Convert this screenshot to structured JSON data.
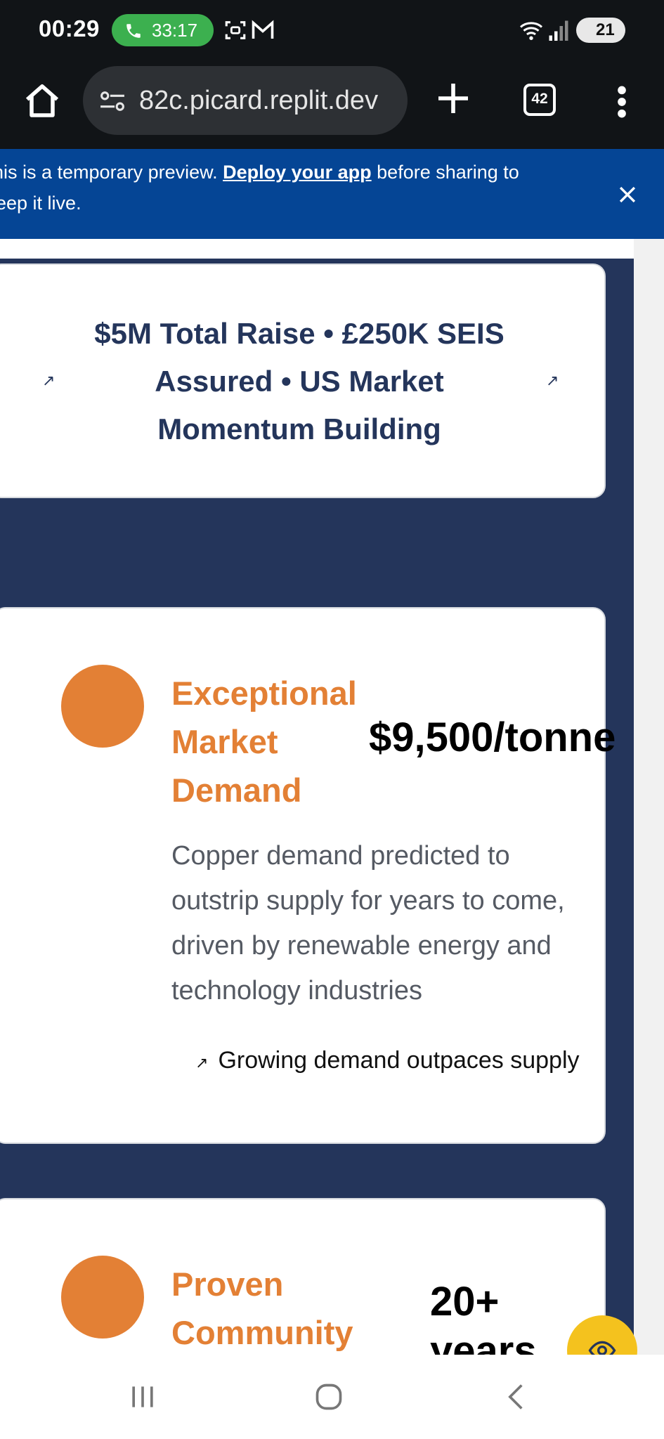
{
  "status_bar": {
    "time": "00:29",
    "call_timer": "33:17",
    "battery": "21",
    "icons": [
      "phone-icon",
      "screenshot-icon",
      "gmail-icon",
      "wifi-icon",
      "signal-icon",
      "battery-icon"
    ]
  },
  "browser": {
    "url": "82c.picard.replit.dev",
    "tab_count": "42",
    "icons": [
      "home-icon",
      "site-settings-icon",
      "new-tab-icon",
      "more-menu-icon"
    ]
  },
  "banner": {
    "text_prefix": "his is a temporary preview. ",
    "link_label": "Deploy your app",
    "text_suffix": " before sharing to",
    "line2": "eep it live.",
    "background": "#054595"
  },
  "hero": {
    "headline": "$5M Total Raise • £250K SEIS Assured • US Market Momentum Building",
    "icon_left": "↗",
    "icon_right": "↗"
  },
  "features": [
    {
      "title": "Exceptional Market Demand",
      "metric": "$9,500/tonne",
      "description_lines": [
        "Copper demand predicted to",
        "outstrip supply for years to come,",
        "driven by renewable energy and",
        "technology industries"
      ],
      "trend": "Growing demand outpaces supply",
      "trend_icon": "↗"
    },
    {
      "title": "Proven Community",
      "metric": "20+",
      "metric_line2": "years"
    }
  ],
  "colors": {
    "navy": "#24355b",
    "accent_orange": "#e38035",
    "fab_yellow": "#f4c21e"
  },
  "fab": {
    "icon": "eye-icon"
  },
  "system_nav": {
    "icons": [
      "recents-icon",
      "home-circle-icon",
      "back-icon"
    ]
  }
}
